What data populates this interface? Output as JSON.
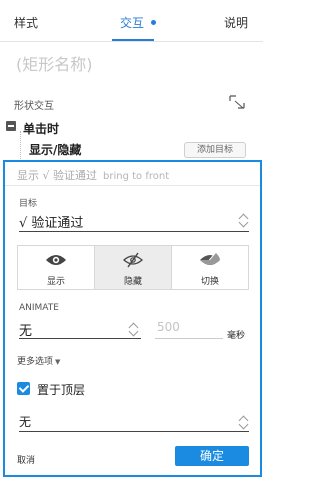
{
  "tabs": [
    {
      "label": "样式"
    },
    {
      "label": "交互"
    },
    {
      "label": "说明"
    }
  ],
  "shape_name_placeholder": "(矩形名称)",
  "section": {
    "title": "形状交互",
    "icon": "expand-corner-icon"
  },
  "event": {
    "label": "单击时",
    "action_label": "显示/隐藏",
    "add_target_label": "添加目标"
  },
  "editor": {
    "summary_cn": "显示 √ 验证通过",
    "summary_en": "bring to front",
    "target_label": "目标",
    "target_value": "√ 验证通过",
    "visibility_options": [
      {
        "label": "显示",
        "icon": "eye-icon"
      },
      {
        "label": "隐藏",
        "icon": "eye-slash-icon"
      },
      {
        "label": "切换",
        "icon": "eye-toggle-icon"
      }
    ],
    "active_option": "隐藏",
    "animate_label": "ANIMATE",
    "animate_value": "无",
    "duration_value": "500",
    "duration_unit": "毫秒",
    "more_options_label": "更多选项",
    "bring_to_front_label": "置于顶层",
    "bring_to_front_checked": true,
    "front_select_value": "无",
    "cancel_label": "取消",
    "ok_label": "确定"
  },
  "colors": {
    "accent": "#1a8be0",
    "tab_active": "#2a7dd6"
  }
}
